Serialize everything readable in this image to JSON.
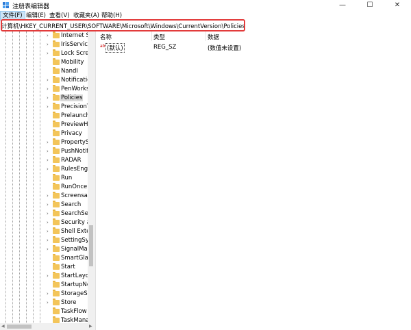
{
  "window": {
    "title": "注册表编辑器",
    "minimize": "—",
    "maximize": "☐",
    "close": "✕"
  },
  "menu": [
    {
      "label": "文件(F)",
      "active": true
    },
    {
      "label": "编辑(E)",
      "active": false
    },
    {
      "label": "查看(V)",
      "active": false
    },
    {
      "label": "收藏夹(A)",
      "active": false
    },
    {
      "label": "帮助(H)",
      "active": false
    }
  ],
  "address": {
    "path": "计算机\\HKEY_CURRENT_USER\\SOFTWARE\\Microsoft\\Windows\\CurrentVersion\\Policies",
    "highlight_color": "#e23b3b"
  },
  "tree": {
    "items": [
      {
        "label": "Internet Se",
        "expandable": true
      },
      {
        "label": "IrisService",
        "expandable": true
      },
      {
        "label": "Lock Scree",
        "expandable": true
      },
      {
        "label": "Mobility",
        "expandable": false
      },
      {
        "label": "NandI",
        "expandable": false
      },
      {
        "label": "Notification",
        "expandable": true
      },
      {
        "label": "PenWorks",
        "expandable": true
      },
      {
        "label": "Policies",
        "expandable": true,
        "selected": true
      },
      {
        "label": "PrecisionT",
        "expandable": true
      },
      {
        "label": "Prelaunch",
        "expandable": false
      },
      {
        "label": "PreviewHa",
        "expandable": false
      },
      {
        "label": "Privacy",
        "expandable": false
      },
      {
        "label": "PropertySy",
        "expandable": true
      },
      {
        "label": "PushNotifi",
        "expandable": true
      },
      {
        "label": "RADAR",
        "expandable": true
      },
      {
        "label": "RulesEngin",
        "expandable": true
      },
      {
        "label": "Run",
        "expandable": false
      },
      {
        "label": "RunOnce",
        "expandable": false
      },
      {
        "label": "Screensav",
        "expandable": true
      },
      {
        "label": "Search",
        "expandable": true
      },
      {
        "label": "SearchSett",
        "expandable": true
      },
      {
        "label": "Security ar",
        "expandable": true
      },
      {
        "label": "Shell Exter",
        "expandable": true
      },
      {
        "label": "SettingSyn",
        "expandable": true
      },
      {
        "label": "SignalMan",
        "expandable": true
      },
      {
        "label": "SmartGlas",
        "expandable": false
      },
      {
        "label": "Start",
        "expandable": false
      },
      {
        "label": "StartLayou",
        "expandable": true
      },
      {
        "label": "StartupNo",
        "expandable": false
      },
      {
        "label": "StorageSe",
        "expandable": true
      },
      {
        "label": "Store",
        "expandable": true
      },
      {
        "label": "TaskFlow",
        "expandable": false
      },
      {
        "label": "TaskMana",
        "expandable": false
      }
    ]
  },
  "list": {
    "columns": [
      "名称",
      "类型",
      "数据"
    ],
    "rows": [
      {
        "icon": "ab",
        "name": "(默认)",
        "type": "REG_SZ",
        "data": "(数值未设置)"
      }
    ]
  },
  "colors": {
    "folder": "#f3c55a",
    "selection": "#d9d9d9",
    "menu_active": "#cce4f7"
  }
}
